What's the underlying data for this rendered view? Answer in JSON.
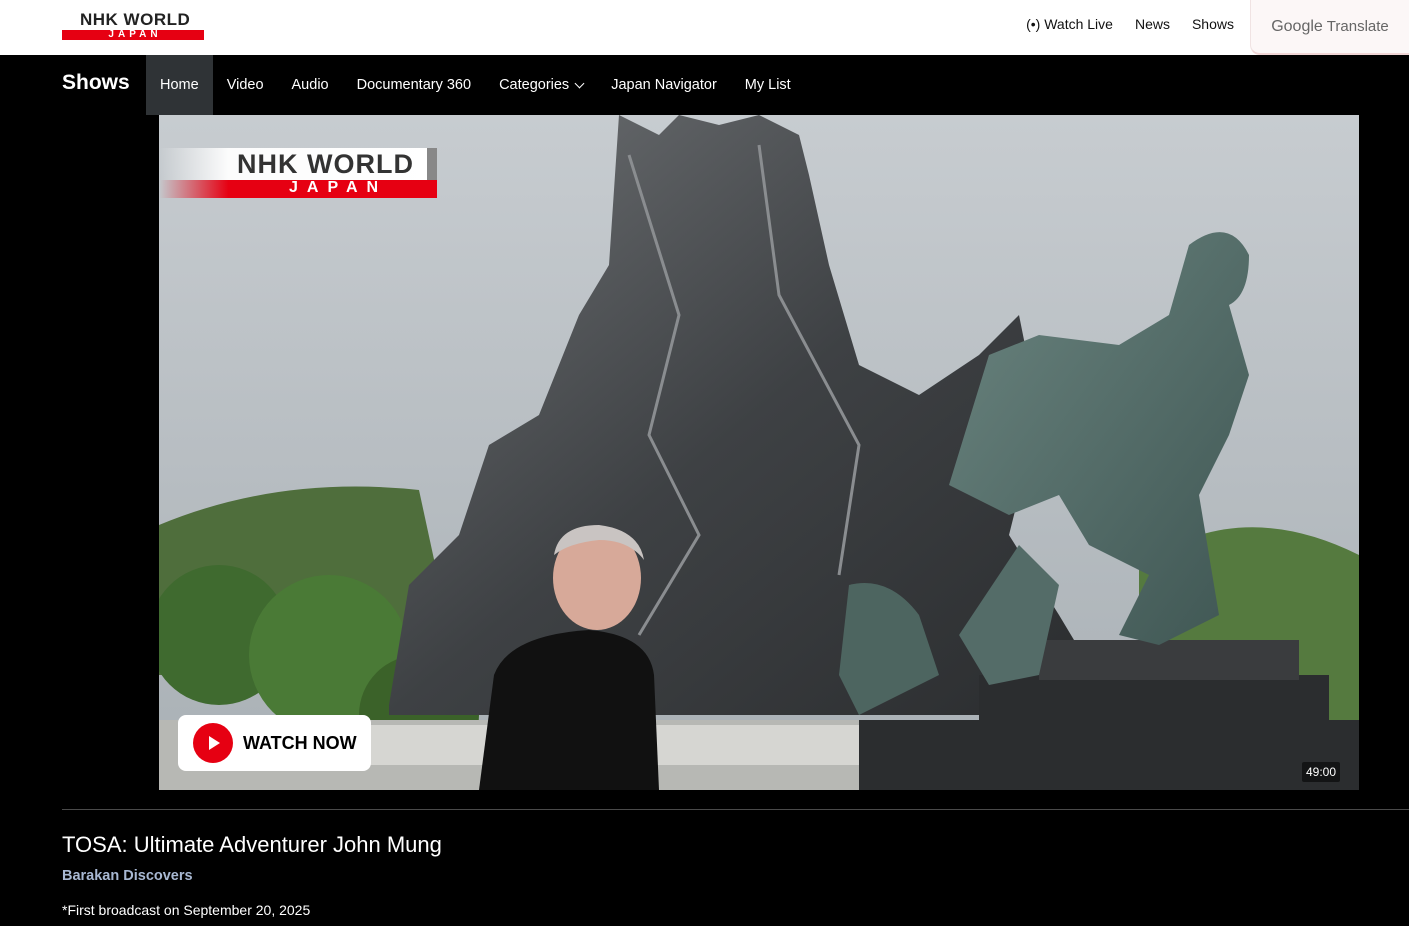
{
  "header": {
    "logo": {
      "word": "NHK WORLD",
      "sub": "JAPAN"
    },
    "nav": [
      {
        "label": "Watch Live",
        "icon": "live-broadcast-icon"
      },
      {
        "label": "News"
      },
      {
        "label": "Shows"
      }
    ],
    "translate": {
      "brand": "Google",
      "label": "Translate"
    }
  },
  "shows_nav": {
    "title": "Shows",
    "items": [
      {
        "label": "Home",
        "active": true
      },
      {
        "label": "Video"
      },
      {
        "label": "Audio"
      },
      {
        "label": "Documentary 360"
      },
      {
        "label": "Categories",
        "icon": "chevron-down-icon"
      },
      {
        "label": "Japan Navigator"
      },
      {
        "label": "My List"
      }
    ]
  },
  "hero": {
    "logo": {
      "word": "NHK WORLD",
      "sub": "JAPAN"
    },
    "watch_button": "WATCH NOW",
    "duration": "49:00",
    "colors": {
      "accent": "#e60012"
    }
  },
  "episode": {
    "title": "TOSA: Ultimate Adventurer John Mung",
    "program": "Barakan Discovers",
    "broadcast": "*First broadcast on September 20, 2025"
  }
}
